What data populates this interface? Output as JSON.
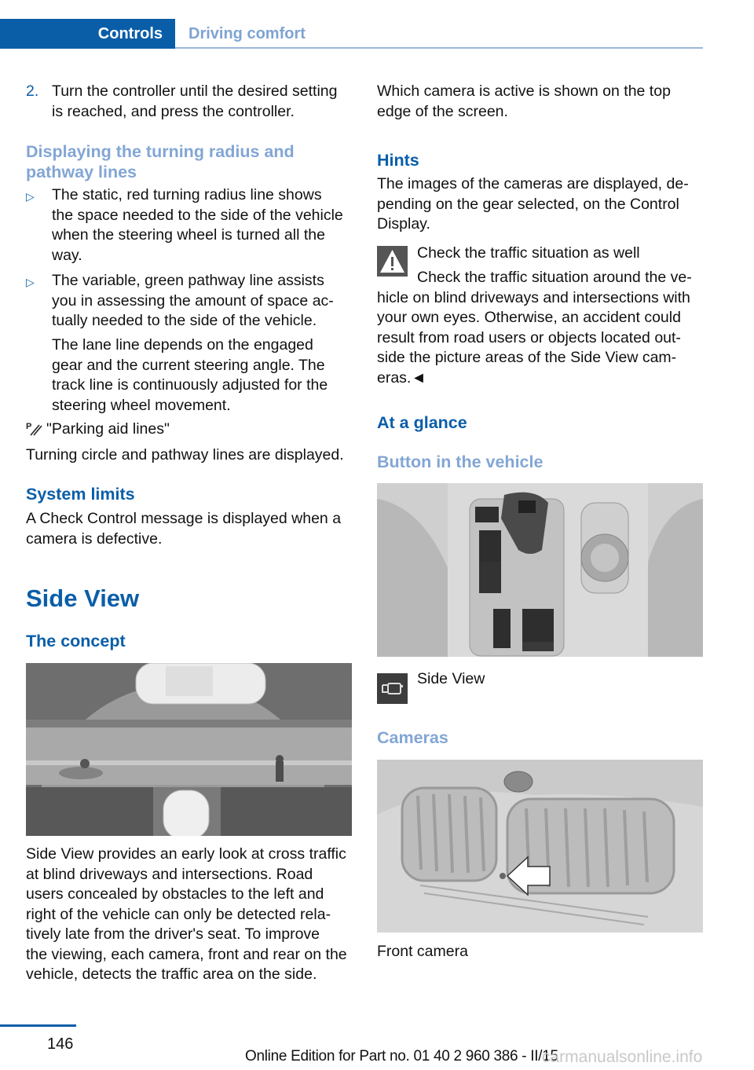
{
  "header": {
    "active_tab": "Controls",
    "inactive_tab": "Driving comfort"
  },
  "left": {
    "step2_number": "2.",
    "step2_lines": [
      "Turn the controller until the desired setting",
      "is reached, and press the controller."
    ],
    "heading_turning": [
      "Displaying the turning radius and",
      "pathway lines"
    ],
    "bullet1_lines": [
      "The static, red turning radius line shows",
      "the space needed to the side of the vehicle",
      "when the steering wheel is turned all the",
      "way."
    ],
    "bullet2_lines": [
      "The variable, green pathway line assists",
      "you in assessing the amount of space ac-",
      "tually needed to the side of the vehicle."
    ],
    "bullet2_extra_lines": [
      "The lane line depends on the engaged",
      "gear and the current steering angle. The",
      "track line is continuously adjusted for the",
      "steering wheel movement."
    ],
    "parking_aid_label": "\"Parking aid lines\"",
    "parking_aid_desc": "Turning circle and pathway lines are displayed.",
    "system_limits_heading": "System limits",
    "system_limits_lines": [
      "A Check Control message is displayed when a",
      "camera is defective."
    ],
    "side_view_heading": "Side View",
    "concept_heading": "The concept",
    "concept_lines": [
      "Side View provides an early look at cross traffic",
      "at blind driveways and intersections. Road",
      "users concealed by obstacles to the left and",
      "right of the vehicle can only be detected rela-",
      "tively late from the driver's seat. To improve",
      "the viewing, each camera, front and rear on the",
      "vehicle, detects the traffic area on the side."
    ]
  },
  "right": {
    "intro_lines": [
      "Which camera is active is shown on the top",
      "edge of the screen."
    ],
    "hints_heading": "Hints",
    "hints_lines": [
      "The images of the cameras are displayed, de-",
      "pending on the gear selected, on the Control",
      "Display."
    ],
    "warning_title": "Check the traffic situation as well",
    "warning_lines": [
      "Check the traffic situation around the ve-",
      "hicle on blind driveways and intersections with",
      "your own eyes. Otherwise, an accident could",
      "result from road users or objects located out-",
      "side the picture areas of the Side View cam-",
      "eras.◄"
    ],
    "at_a_glance_heading": "At a glance",
    "button_heading": "Button in the vehicle",
    "side_view_button_label": "Side View",
    "cameras_heading": "Cameras",
    "front_camera_caption": "Front camera"
  },
  "footer": {
    "page_number": "146",
    "edition_text": "Online Edition for Part no. 01 40 2 960 386 - II/15",
    "watermark": "carmanualsonline.info"
  },
  "colors": {
    "brand_blue": "#0a5ea8",
    "light_blue": "#82a6d5"
  }
}
